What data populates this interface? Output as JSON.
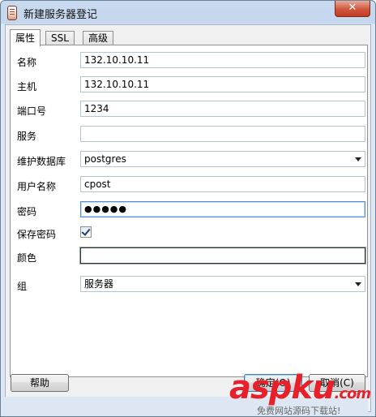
{
  "window": {
    "title": "新建服务器登记",
    "close_label": "✕"
  },
  "tabs": [
    {
      "label": "属性",
      "active": true
    },
    {
      "label": "SSL",
      "active": false
    },
    {
      "label": "高级",
      "active": false
    }
  ],
  "form": {
    "name": {
      "label": "名称",
      "value": "132.10.10.11"
    },
    "host": {
      "label": "主机",
      "value": "132.10.10.11"
    },
    "port": {
      "label": "端口号",
      "value": "1234"
    },
    "service": {
      "label": "服务",
      "value": ""
    },
    "maintenance_db": {
      "label": "维护数据库",
      "value": "postgres"
    },
    "username": {
      "label": "用户名称",
      "value": "cpost"
    },
    "password": {
      "label": "密码",
      "value": "●●●●●"
    },
    "save_password": {
      "label": "保存密码",
      "checked": true
    },
    "color": {
      "label": "颜色"
    },
    "group": {
      "label": "组",
      "value": "服务器"
    }
  },
  "buttons": {
    "help": "帮助",
    "ok": "确定(O)",
    "cancel": "取消(C)"
  },
  "watermark": {
    "logo": "aspku",
    "sub": ".com",
    "tagline": "免费网站源码下载站!"
  }
}
